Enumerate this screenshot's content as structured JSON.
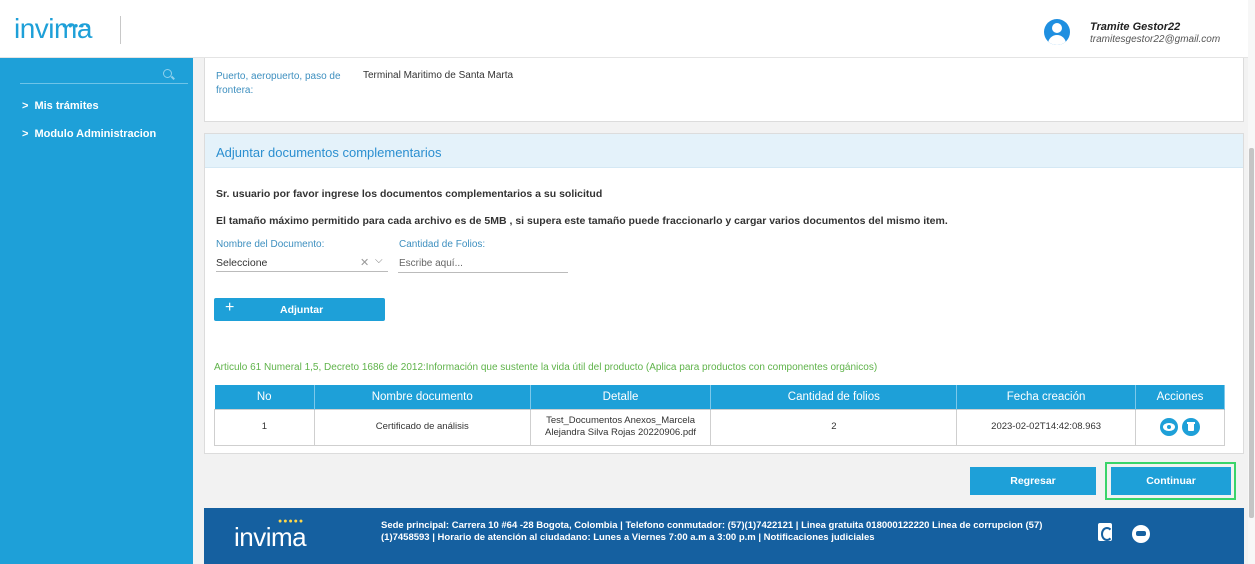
{
  "brand": {
    "logo": "invima",
    "accent": "#1ea0d8",
    "footer_bg": "#1560a0"
  },
  "user": {
    "name": "Tramite Gestor22",
    "email": "tramitesgestor22@gmail.com"
  },
  "sidebar": {
    "items": [
      {
        "label": "Mis trámites",
        "icon": "chevron-right-icon"
      },
      {
        "label": "Modulo Administracion",
        "icon": "chevron-right-icon"
      }
    ]
  },
  "puerto": {
    "label": "Puerto, aeropuerto, paso de frontera:",
    "value": "Terminal Maritimo de Santa Marta"
  },
  "adjuntar": {
    "title": "Adjuntar documentos complementarios",
    "notice1": "Sr. usuario por favor ingrese los documentos complementarios a su solicitud",
    "notice2": "El tamaño máximo permitido para cada archivo es de 5MB , si supera este tamaño puede fraccionarlo y cargar varios documentos del mismo item.",
    "nombre_label": "Nombre del Documento:",
    "nombre_value": "Seleccione",
    "folios_label": "Cantidad de Folios:",
    "folios_placeholder": "Escribe aquí...",
    "attach_button": "Adjuntar",
    "articulo": "Articulo 61 Numeral 1,5, Decreto 1686 de 2012:Información que sustente la vida útil del producto (Aplica para productos con componentes orgánicos)"
  },
  "table": {
    "headers": [
      "No",
      "Nombre documento",
      "Detalle",
      "Cantidad de folios",
      "Fecha creación",
      "Acciones"
    ],
    "rows": [
      {
        "no": "1",
        "nombre": "Certificado de análisis",
        "detalle": "Test_Documentos Anexos_Marcela Alejandra Silva Rojas 20220906.pdf",
        "folios": "2",
        "fecha": "2023-02-02T14:42:08.963"
      }
    ]
  },
  "buttons": {
    "regresar": "Regresar",
    "continuar": "Continuar"
  },
  "footer": {
    "logo": "invima",
    "text": "Sede principal: Carrera 10 #64 -28 Bogota, Colombia | Telefono conmutador: (57)(1)7422121 | Linea gratuita 018000122220 Linea de corrupcion (57)(1)7458593 | Horario de atención al ciudadano: Lunes a Viernes 7:00 a.m a 3:00 p.m | Notificaciones judiciales"
  }
}
